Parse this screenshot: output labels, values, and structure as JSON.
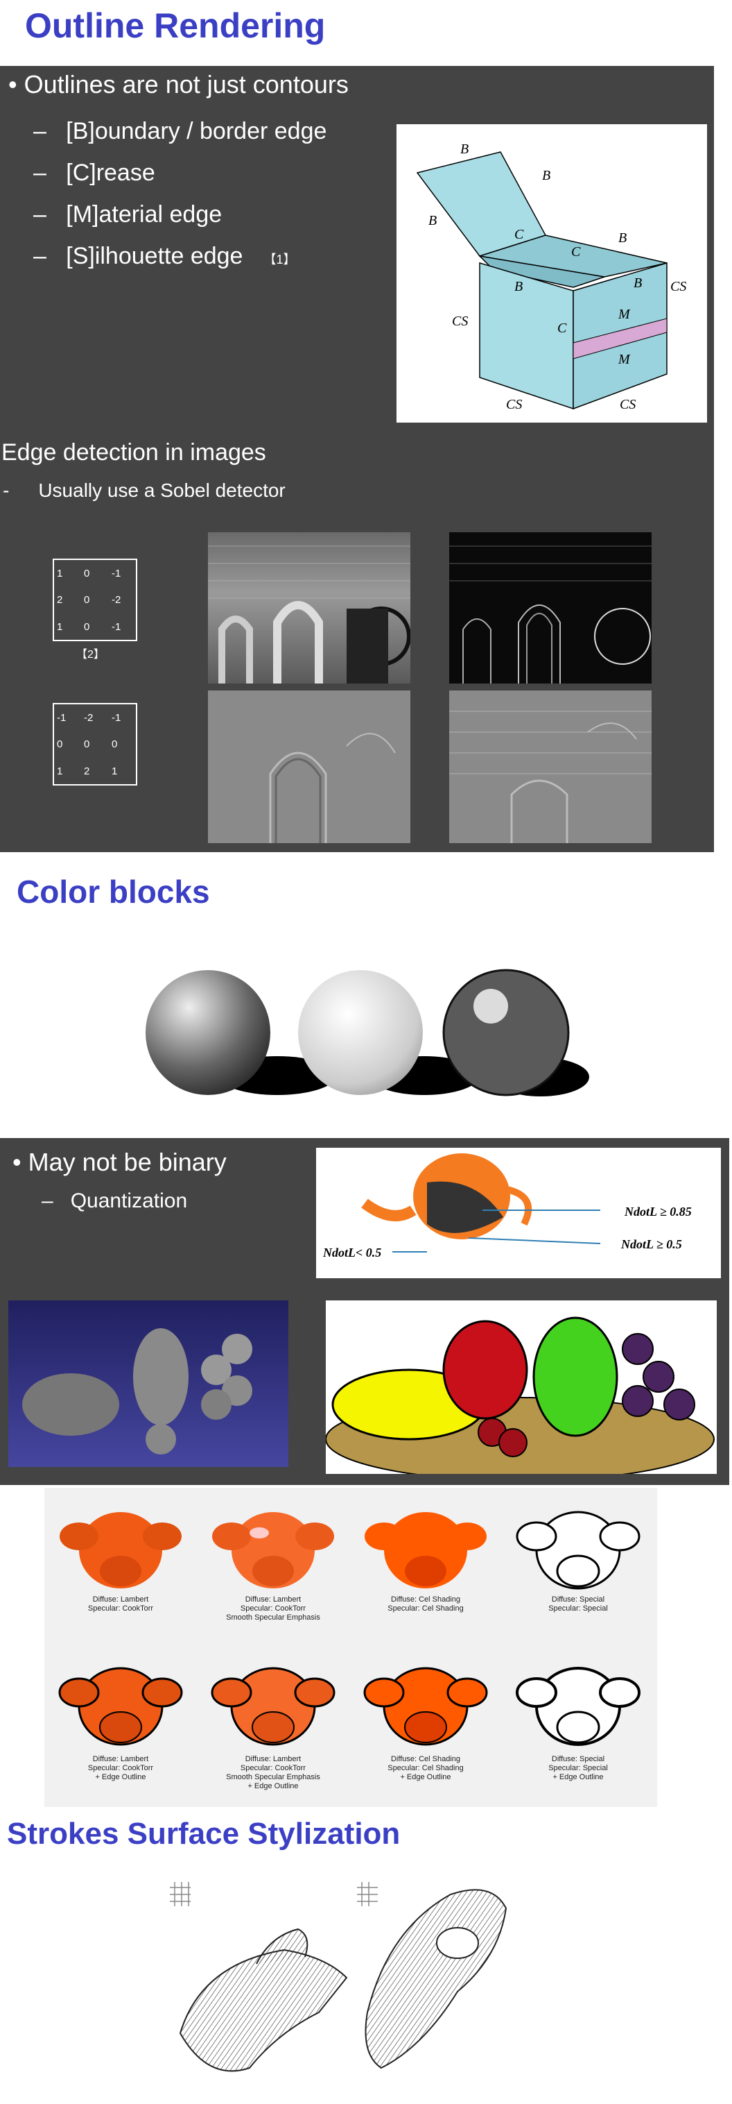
{
  "outline": {
    "title": "Outline Rendering",
    "bullet": "Outlines are not just contours",
    "items": [
      "[B]oundary / border edge",
      "[C]rease",
      "[M]aterial edge",
      "[S]ilhouette edge"
    ],
    "ref1": "【1】",
    "cube_labels": {
      "b": "B",
      "c": "C",
      "m": "M",
      "cs": "CS"
    },
    "edge_heading": "Edge detection in images",
    "edge_dash": "-",
    "edge_sub": "Usually use a Sobel detector",
    "sobel_x": [
      [
        "1",
        "0",
        "-1"
      ],
      [
        "2",
        "0",
        "-2"
      ],
      [
        "1",
        "0",
        "-1"
      ]
    ],
    "sobel_y": [
      [
        "-1",
        "-2",
        "-1"
      ],
      [
        "0",
        "0",
        "0"
      ],
      [
        "1",
        "2",
        "1"
      ]
    ],
    "ref2": "【2】"
  },
  "color_blocks": {
    "title": "Color blocks",
    "bullet": "May not be binary",
    "sub": "Quantization",
    "teapot_labels": [
      "NdotL ≥  0.85",
      "NdotL ≥  0.5",
      "NdotL< 0.5"
    ]
  },
  "monkeys": {
    "captions": [
      [
        "Diffuse: Lambert",
        "Specular: CookTorr"
      ],
      [
        "Diffuse: Lambert",
        "Specular: CookTorr",
        "Smooth Specular Emphasis"
      ],
      [
        "Diffuse: Cel Shading",
        "Specular: Cel Shading"
      ],
      [
        "Diffuse: Special",
        "Specular: Special"
      ],
      [
        "Diffuse: Lambert",
        "Specular: CookTorr",
        "+ Edge Outline"
      ],
      [
        "Diffuse: Lambert",
        "Specular: CookTorr",
        "Smooth Specular Emphasis",
        "+ Edge Outline"
      ],
      [
        "Diffuse: Cel Shading",
        "Specular: Cel Shading",
        "+ Edge Outline"
      ],
      [
        "Diffuse: Special",
        "Specular: Special",
        "+ Edge Outline"
      ]
    ]
  },
  "strokes": {
    "title": "Strokes Surface Stylization"
  },
  "colors": {
    "title": "#3b3fc4",
    "slide": "#444444",
    "cube": "#a8dde6",
    "stripe": "#d9a9d6"
  }
}
